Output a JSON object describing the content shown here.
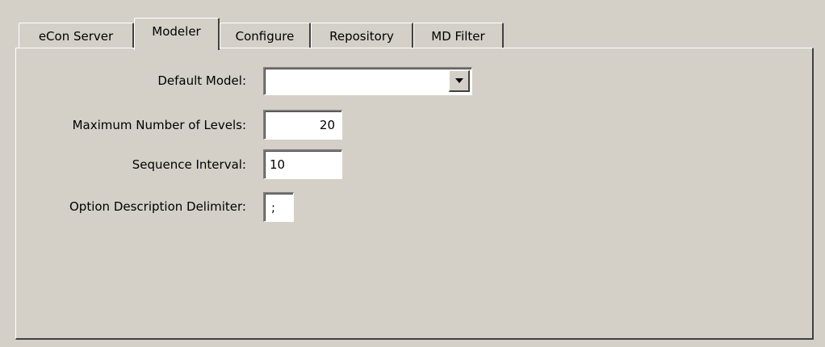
{
  "tabs": [
    {
      "label": "eCon Server",
      "active": false
    },
    {
      "label": "Modeler",
      "active": true
    },
    {
      "label": "Configure",
      "active": false
    },
    {
      "label": "Repository",
      "active": false
    },
    {
      "label": "MD Filter",
      "active": false
    }
  ],
  "form": {
    "default_model": {
      "label": "Default Model:",
      "value": ""
    },
    "max_levels": {
      "label": "Maximum Number of Levels:",
      "value": "20"
    },
    "sequence_interval": {
      "label": "Sequence Interval:",
      "value": "10"
    },
    "option_delimiter": {
      "label": "Option Description Delimiter:",
      "value": ";"
    }
  },
  "icons": {
    "combo_arrow": "chevron-down-icon"
  }
}
